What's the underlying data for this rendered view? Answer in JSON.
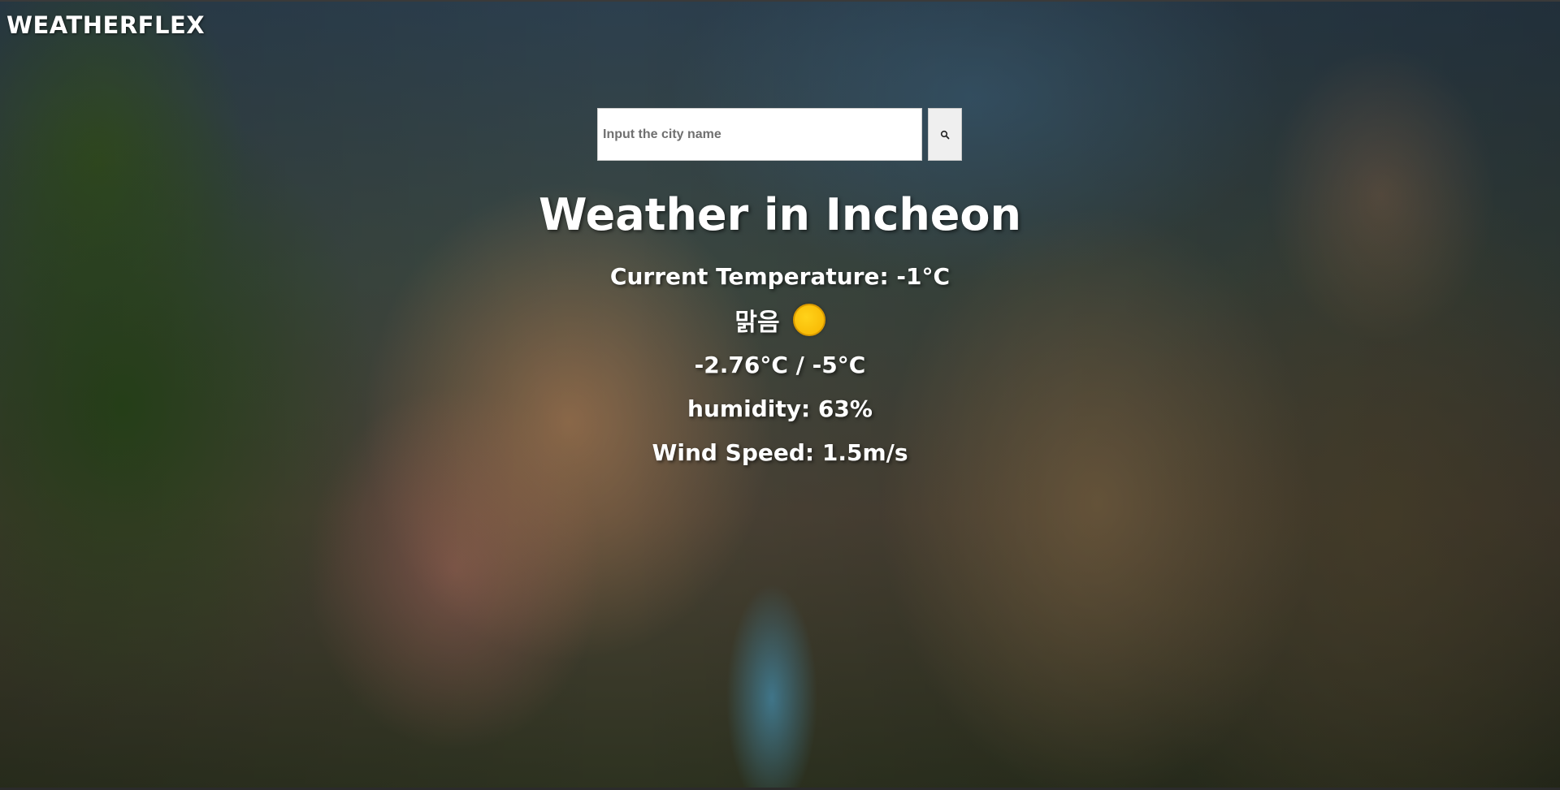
{
  "app": {
    "brand": "WEATHERFLEX"
  },
  "search": {
    "placeholder": "Input the city name",
    "value": "",
    "button_icon": "search-icon"
  },
  "weather": {
    "title": "Weather in Incheon",
    "current_temperature": "Current Temperature: -1°C",
    "condition": "맑음",
    "condition_icon": "sun-icon",
    "temp_range": "-2.76°C / -5°C",
    "humidity": "humidity: 63%",
    "wind_speed": "Wind Speed: 1.5m/s"
  },
  "colors": {
    "sun": "#f7b400",
    "text": "#ffffff"
  }
}
